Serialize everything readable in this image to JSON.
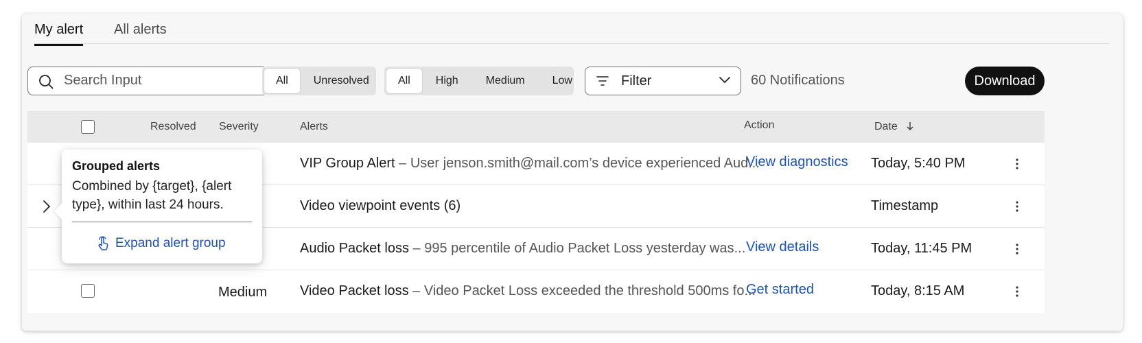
{
  "tabs": [
    {
      "label": "My alert",
      "active": true
    },
    {
      "label": "All alerts",
      "active": false
    }
  ],
  "toolbar": {
    "search_placeholder": "Search Input",
    "status_segments": [
      "All",
      "Unresolved"
    ],
    "severity_segments": [
      "All",
      "High",
      "Medium",
      "Low"
    ],
    "filter_label": "Filter",
    "notification_count": "60 Notifications",
    "download_label": "Download"
  },
  "table": {
    "headers": {
      "resolved": "Resolved",
      "severity": "Severity",
      "alerts": "Alerts",
      "action": "Action",
      "date": "Date"
    },
    "rows": [
      {
        "severity": "",
        "title": "VIP Group Alert",
        "separator": " – ",
        "detail": "User jenson.smith@mail.com’s device experienced Aud...",
        "action": "View diagnostics",
        "date": "Today, 5:40 PM"
      },
      {
        "severity": "",
        "title": "Video viewpoint events (6)",
        "separator": "",
        "detail": "",
        "action": "",
        "date": "Timestamp"
      },
      {
        "severity": "",
        "title": "Audio Packet loss",
        "separator": " – ",
        "detail": "995 percentile of Audio Packet Loss yesterday was...",
        "action": "View details",
        "date": "Today, 11:45 PM"
      },
      {
        "severity": "Medium",
        "title": "Video Packet loss",
        "separator": " – ",
        "detail": "Video Packet Loss exceeded the threshold 500ms fo...",
        "action": "Get started",
        "date": "Today, 8:15 AM"
      }
    ]
  },
  "tooltip": {
    "title": "Grouped alerts",
    "body": "Combined by {target}, {alert type}, within last 24 hours.",
    "link": "Expand alert group"
  },
  "colors": {
    "link": "#1f53a8",
    "primary_button": "#111111",
    "header_bg": "#e9e9e9"
  }
}
